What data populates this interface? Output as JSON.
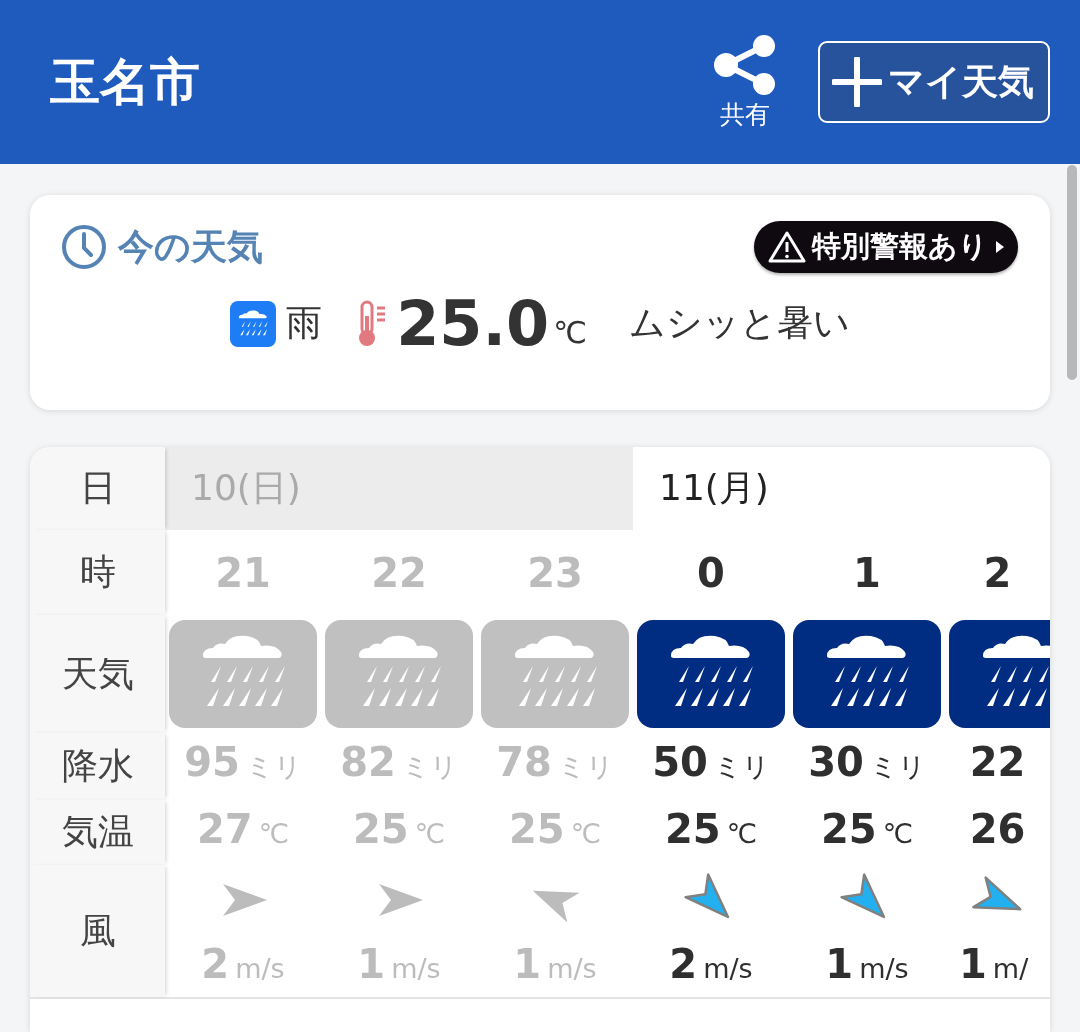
{
  "header": {
    "title": "玉名市",
    "share_label": "共有",
    "my_weather_button": "マイ天気"
  },
  "current": {
    "title": "今の天気",
    "alert_badge": "特別警報あり",
    "weather": "雨",
    "temperature": "25.0",
    "temperature_unit": "℃",
    "comment": "ムシッと暑い"
  },
  "forecast": {
    "row_labels": [
      "日",
      "時",
      "天気",
      "降水",
      "気温",
      "風"
    ],
    "days": [
      {
        "label": "10(日)",
        "past": true,
        "hours": [
          {
            "hour": "21",
            "past": true,
            "precip": "95",
            "precip_unit": "ミリ",
            "temp": "27",
            "temp_unit": "℃",
            "wind_arrow": {
              "kind": "east"
            },
            "wind_speed": "2",
            "wind_unit": "m/s"
          },
          {
            "hour": "22",
            "past": true,
            "precip": "82",
            "precip_unit": "ミリ",
            "temp": "25",
            "temp_unit": "℃",
            "wind_arrow": {
              "kind": "east"
            },
            "wind_speed": "1",
            "wind_unit": "m/s"
          },
          {
            "hour": "23",
            "past": true,
            "precip": "78",
            "precip_unit": "ミリ",
            "temp": "25",
            "temp_unit": "℃",
            "wind_arrow": {
              "kind": "westnorthwest"
            },
            "wind_speed": "1",
            "wind_unit": "m/s"
          }
        ]
      },
      {
        "label": "11(月)",
        "past": false,
        "hours": [
          {
            "hour": "0",
            "past": false,
            "precip": "50",
            "precip_unit": "ミリ",
            "temp": "25",
            "temp_unit": "℃",
            "wind_arrow": {
              "kind": "southeast"
            },
            "wind_speed": "2",
            "wind_unit": "m/s"
          },
          {
            "hour": "1",
            "past": false,
            "precip": "30",
            "precip_unit": "ミリ",
            "temp": "25",
            "temp_unit": "℃",
            "wind_arrow": {
              "kind": "southeast"
            },
            "wind_speed": "1",
            "wind_unit": "m/s"
          },
          {
            "hour": "2",
            "past": false,
            "precip": "22",
            "temp": "26",
            "wind_arrow": {
              "kind": "eastsoutheast"
            },
            "wind_speed": "1",
            "wind_unit": "m/"
          }
        ]
      }
    ]
  }
}
